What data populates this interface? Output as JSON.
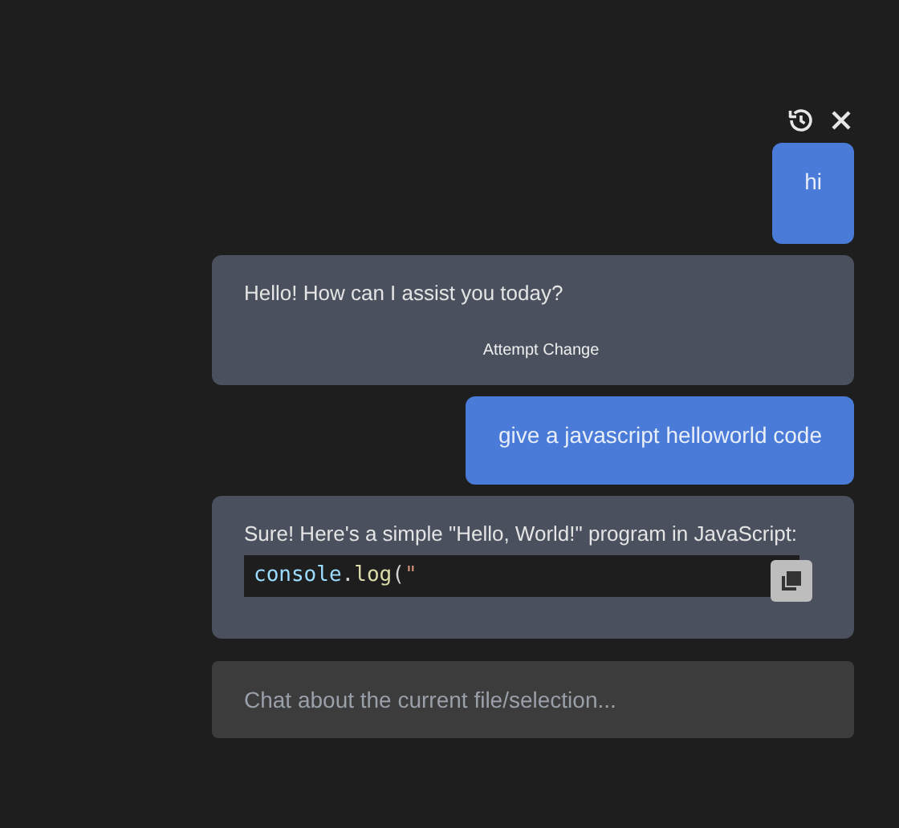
{
  "header": {
    "buttons": [
      {
        "kind": "history"
      },
      {
        "kind": "close"
      }
    ]
  },
  "messages": [
    {
      "kind": "user",
      "text": "hi"
    },
    {
      "kind": "assistant",
      "text": "Hello! How can I assist you today?",
      "action": "Attempt Change"
    },
    {
      "kind": "user",
      "text": "give a javascript helloworld code"
    },
    {
      "kind": "assistant",
      "text": "Sure! Here's a simple \"Hello, World!\" program in JavaScript:",
      "code": [
        {
          "kind": "identifier",
          "text": "console"
        },
        {
          "kind": "punctuation",
          "text": "."
        },
        {
          "kind": "function",
          "text": "log"
        },
        {
          "kind": "punctuation",
          "text": "("
        },
        {
          "kind": "string",
          "text": "\""
        }
      ]
    }
  ],
  "input": {
    "placeholder": "Chat about the current file/selection..."
  }
}
